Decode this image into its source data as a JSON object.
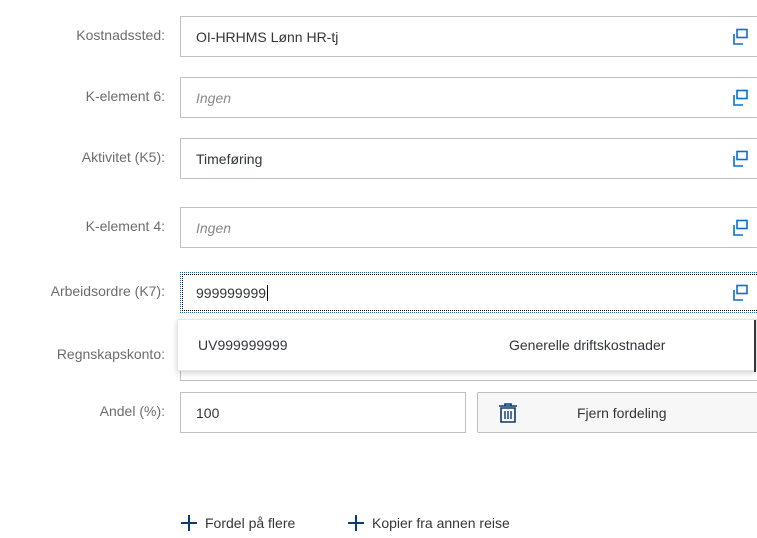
{
  "form": {
    "rows": [
      {
        "label": "Kostnadssted:",
        "value": "OI-HRHMS Lønn HR-tj",
        "placeholder": false
      },
      {
        "label": "K-element 6:",
        "value": "Ingen",
        "placeholder": true
      },
      {
        "label": "Aktivitet (K5):",
        "value": "Timeføring",
        "placeholder": false
      },
      {
        "label": "K-element 4:",
        "value": "Ingen",
        "placeholder": true
      },
      {
        "label": "Arbeidsordre (K7):",
        "value": "999999999",
        "placeholder": false
      },
      {
        "label": "Regnskapskonto:",
        "value": "",
        "placeholder": false
      }
    ],
    "andel": {
      "label": "Andel (%):",
      "value": "100"
    }
  },
  "suggestion": {
    "code": "UV999999999",
    "description": "Generelle driftskostnader"
  },
  "remove_button": {
    "label": "Fjern fordeling",
    "icon": "trash-icon"
  },
  "links": {
    "distribute": "Fordel på flere",
    "copy": "Kopier fra annen reise"
  },
  "colors": {
    "focus": "#0a6ed1",
    "border": "#bfbfbf",
    "label": "#6a6d70",
    "link_icon": "#0a3b70"
  }
}
